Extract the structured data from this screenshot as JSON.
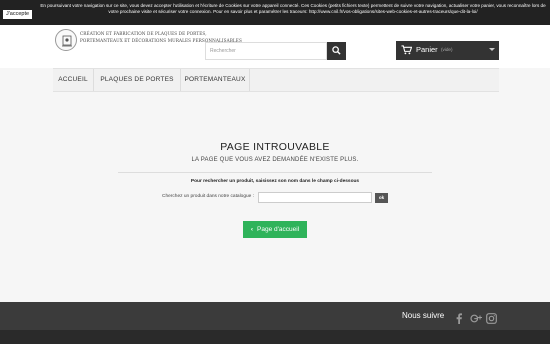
{
  "cookie": {
    "accept_label": "J'accepte",
    "text": "En poursuivant votre navigation sur ce site, vous devez accepter l'utilisation et l'écriture de Cookies sur votre appareil connecté. Ces Cookies (petits fichiers texte) permettent de suivre votre navigation, actualiser votre panier, vous reconnaître lors de votre prochaine visite et sécuriser votre connexion. Pour en savoir plus et paramétrer les traceurs: http://www.cnil.fr/vos-obligations/sites-web-cookies-et-autres-traceurs/que-dit-la-loi/"
  },
  "header": {
    "logo_line1": "CRÉATION ET FABRICATION DE PLAQUES DE PORTES,",
    "logo_line2": "PORTEMANTEAUX ET DÉCORATIONS MURALES PERSONNALISABLES",
    "search_placeholder": "Rechercher",
    "search_icon": "search-icon",
    "cart_label": "Panier",
    "cart_count": "(vide)",
    "cart_icon": "cart-icon"
  },
  "nav": {
    "items": [
      {
        "label": "ACCUEIL"
      },
      {
        "label": "PLAQUES DE PORTES"
      },
      {
        "label": "PORTEMANTEAUX"
      }
    ]
  },
  "main": {
    "title": "PAGE INTROUVABLE",
    "subtitle": "LA PAGE QUE VOUS AVEZ DEMANDÉE N'EXISTE PLUS.",
    "hint": "Pour rechercher un produit, saisissez son nom dans le champ ci-dessous",
    "catalog_label": "Cherchez un produit dans notre catalogue :",
    "ok_label": "ok",
    "home_button": "Page d'accueil"
  },
  "footer": {
    "follow_label": "Nous suivre",
    "social": [
      "facebook-icon",
      "google-plus-icon",
      "instagram-icon"
    ]
  },
  "colors": {
    "cookie_bar": "#222222",
    "dark_button": "#333333",
    "home_button": "#2fb35a",
    "footer": "#3b3b3b"
  }
}
